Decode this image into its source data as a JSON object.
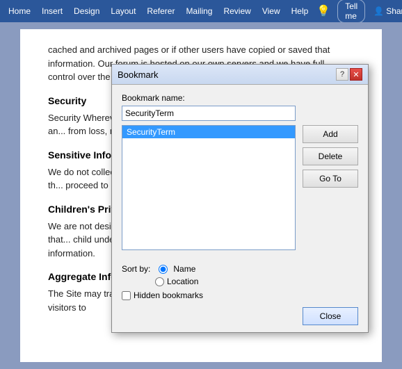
{
  "ribbon": {
    "tabs": [
      "Home",
      "Insert",
      "Design",
      "Layout",
      "Referer",
      "Mailing",
      "Review",
      "View",
      "Help"
    ],
    "tell_me_placeholder": "Tell me",
    "share_label": "Share"
  },
  "document": {
    "paragraphs": [
      {
        "type": "text",
        "content": "cached and archived pages or if other users have copied or saved that information. Our forum is hosted on our own servers and we have full control over the data and ability to remove conte..."
      },
      {
        "type": "heading",
        "content": "Security"
      },
      {
        "type": "text",
        "content": "Security Wherever your... our behalf, reasonable a... like technologies, are an... from loss, misuse, or un..."
      },
      {
        "type": "heading",
        "content": "Sensitive Informatio..."
      },
      {
        "type": "text",
        "content": "We do not collect Sensiti... political, religious, philo... If we are made aware th... proceed to its deletion."
      },
      {
        "type": "heading",
        "content": "Children's Privacy"
      },
      {
        "type": "text",
        "content": "We are not designed nor... to collect Personal Infor... we are made aware that... child under the age of thirteen, we will promptly delete that information."
      },
      {
        "type": "heading",
        "content": "Aggregate Information"
      },
      {
        "type": "text",
        "content": "The Site may track the total number of visitors to our Site, the number of visitors to"
      }
    ]
  },
  "dialog": {
    "title": "Bookmark",
    "bookmark_name_label": "Bookmark name:",
    "bookmark_input_value": "SecurityTerm",
    "list_items": [
      "SecurityTerm"
    ],
    "selected_item": "SecurityTerm",
    "add_button": "Add",
    "delete_button": "Delete",
    "goto_button": "Go To",
    "sort_by_label": "Sort by:",
    "sort_name_label": "Name",
    "sort_location_label": "Location",
    "hidden_bookmarks_label": "Hidden bookmarks",
    "close_button": "Close"
  }
}
